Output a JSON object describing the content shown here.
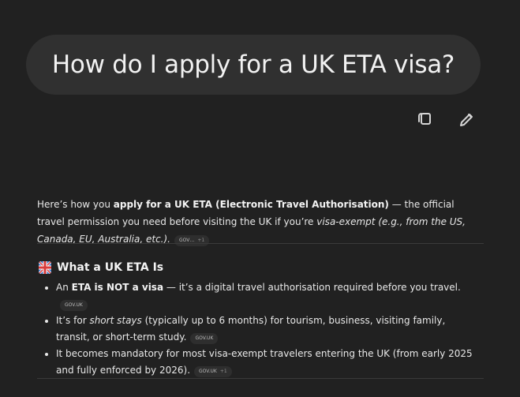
{
  "question": "How do I apply for a UK ETA visa?",
  "actions": {
    "copy_icon": "copy-icon",
    "edit_icon": "edit-icon"
  },
  "response": {
    "intro": {
      "text_1": "Here’s how you ",
      "bold_1": "apply for a UK ETA (Electronic Travel Authorisation)",
      "text_2": " — the official travel permission you need before visiting the UK if you’re ",
      "italic_1": "visa-exempt (e.g., from the US, Canada, EU, Australia, etc.).",
      "source_label": "GOV…",
      "source_more": "+1"
    },
    "section": {
      "icon": "uk-flag-icon",
      "title": "What a UK ETA Is"
    },
    "bullets": [
      {
        "before": "An ",
        "bold": "ETA is NOT a visa",
        "after": " — it’s a digital travel authorisation required before you travel.",
        "source_label": "GOV.UK",
        "source_more": ""
      },
      {
        "before": "It’s for ",
        "italic": "short stays",
        "after": " (typically up to 6 months) for tourism, business, visiting family, transit, or short-term study.",
        "source_label": "GOV.UK",
        "source_more": ""
      },
      {
        "before": "It becomes mandatory for most visa-exempt travelers entering the UK (from early 2025 and fully enforced by 2026).",
        "source_label": "GOV.UK",
        "source_more": "+1"
      }
    ]
  },
  "colors": {
    "background": "#212121",
    "bubble": "#303030",
    "text": "#e8e8e8",
    "muted": "#bdbdbd",
    "divider": "#3a3a3a",
    "section_icon": "#4a90d9"
  }
}
